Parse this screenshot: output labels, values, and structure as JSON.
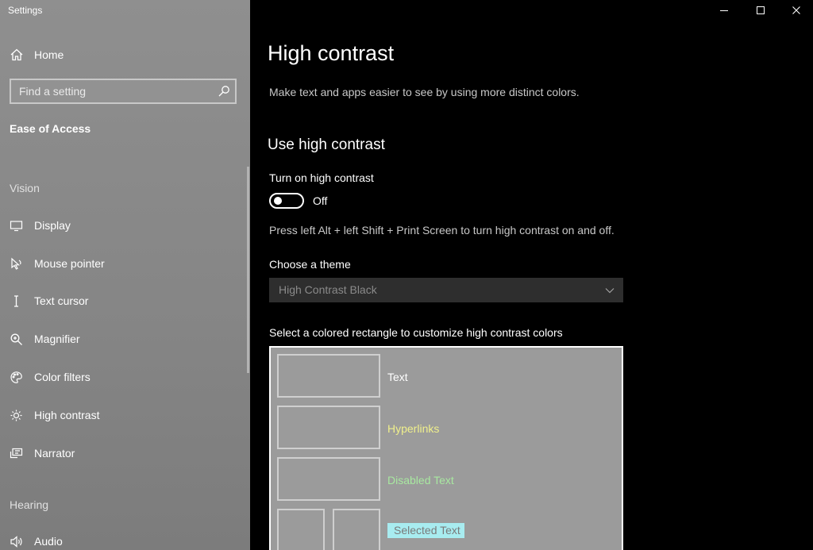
{
  "window": {
    "title": "Settings"
  },
  "sidebar": {
    "home_label": "Home",
    "search_placeholder": "Find a setting",
    "category": "Ease of Access",
    "groups": {
      "vision": "Vision",
      "hearing": "Hearing"
    },
    "items": [
      {
        "label": "Display",
        "icon": "display-icon"
      },
      {
        "label": "Mouse pointer",
        "icon": "mouse-pointer-icon"
      },
      {
        "label": "Text cursor",
        "icon": "text-cursor-icon"
      },
      {
        "label": "Magnifier",
        "icon": "magnifier-icon"
      },
      {
        "label": "Color filters",
        "icon": "palette-icon"
      },
      {
        "label": "High contrast",
        "icon": "sun-icon"
      },
      {
        "label": "Narrator",
        "icon": "narrator-icon"
      },
      {
        "label": "Audio",
        "icon": "speaker-icon"
      }
    ]
  },
  "main": {
    "title": "High contrast",
    "description": "Make text and apps easier to see by using more distinct colors.",
    "section_title": "Use high contrast",
    "toggle_label": "Turn on high contrast",
    "toggle_state": "Off",
    "shortcut_hint": "Press left Alt + left Shift + Print Screen to turn high contrast on and off.",
    "theme_label": "Choose a theme",
    "theme_value": "High Contrast Black",
    "colors_label": "Select a colored rectangle to customize high contrast colors",
    "color_items": {
      "text": "Text",
      "hyperlinks": "Hyperlinks",
      "disabled_text": "Disabled Text",
      "selected_text": "Selected Text"
    }
  },
  "colors": {
    "sidebar_bg": "#8a8a8a",
    "main_bg": "#000000",
    "hyperlink": "#f0f08c",
    "disabled": "#a8e8a0",
    "selected_bg": "#a8ecf0"
  }
}
